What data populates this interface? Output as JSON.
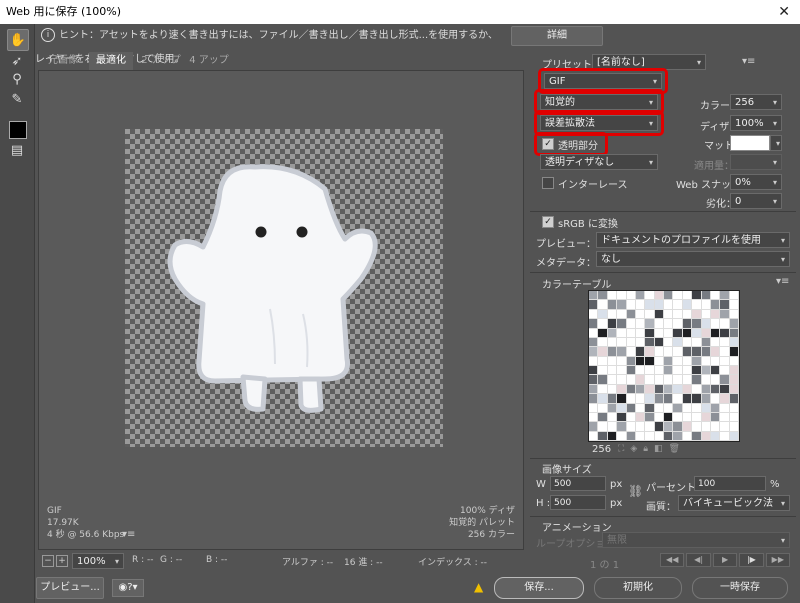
{
  "window": {
    "title": "Web 用に保存 (100%)",
    "close_glyph": "✕"
  },
  "hint": {
    "text": "ヒント：アセットをより速く書き出すには、ファイル／書き出し／書き出し形式...を使用するか、レイヤーを右クリックして使用。",
    "details_button": "詳細"
  },
  "tabs": [
    "元画像",
    "最適化",
    "2 アップ",
    "4 アップ"
  ],
  "canvas_info": {
    "format": "GIF",
    "size": "17.97K",
    "time": "4 秒 @ 56.6 Kbps",
    "dither": "100% ディザ",
    "palette": "知覚的 パレット",
    "colors": "256 カラー"
  },
  "status": {
    "zoom": "100%",
    "r": "R : --",
    "g": "G : --",
    "b": "B : --",
    "alpha": "アルファ : --",
    "hex": "16 進 : --",
    "index": "インデックス : --"
  },
  "preset": {
    "label": "プリセット：",
    "value": "[名前なし]"
  },
  "settings": {
    "format": "GIF",
    "reduction": "知覚的",
    "dither_algo": "誤差拡散法",
    "transparency_label": "透明部分",
    "transparency_checked": true,
    "trans_dither": "透明ディザなし",
    "interlace_label": "インターレース",
    "interlace_checked": false,
    "colors_label": "カラー：",
    "colors_value": "256",
    "dither_label": "ディザ：",
    "dither_value": "100%",
    "matte_label": "マット：",
    "matte_color": "#ffffff",
    "amount_label": "適用量：",
    "amount_value": "",
    "websnap_label": "Web スナップ：",
    "websnap_value": "0%",
    "lossy_label": "劣化：",
    "lossy_value": "0",
    "srgb_label": "sRGB に変換",
    "srgb_checked": true,
    "preview_label": "プレビュー：",
    "preview_value": "ドキュメントのプロファイルを使用",
    "metadata_label": "メタデータ：",
    "metadata_value": "なし"
  },
  "color_table": {
    "title": "カラーテーブル",
    "count": "256"
  },
  "image_size": {
    "title": "画像サイズ",
    "w_label": "W :",
    "w_value": "500",
    "h_label": "H :",
    "h_value": "500",
    "unit": "px",
    "percent_label": "パーセント：",
    "percent_value": "100",
    "percent_unit": "%",
    "quality_label": "画質：",
    "quality_value": "バイキュービック法"
  },
  "animation": {
    "title": "アニメーション",
    "loop_label": "ループオプション：",
    "loop_value": "無限",
    "frame": "1 の 1"
  },
  "buttons": {
    "preview": "プレビュー...",
    "save": "保存...",
    "reset": "初期化",
    "remember": "一時保存"
  }
}
